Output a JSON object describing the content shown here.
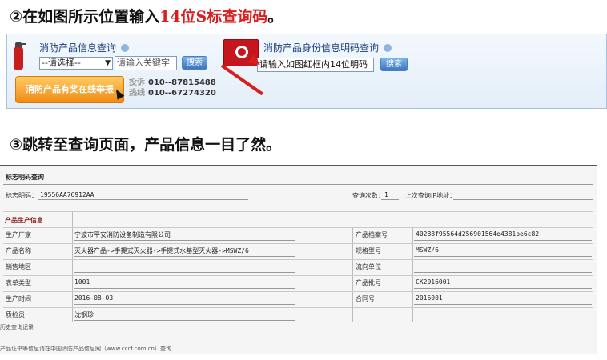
{
  "step2": {
    "prefix": "②在如图所示位置输入",
    "highlight": "14位S标查询码",
    "suffix": "。"
  },
  "step3": {
    "text": "③跳转至查询页面，产品信息一目了然。"
  },
  "search_panel": {
    "product_query_title": "消防产品信息查询",
    "select_value": "--请选择--",
    "keyword_placeholder": "请输入关键字",
    "search_button": "搜索",
    "id_query_title": "消防产品身份信息明码查询",
    "code_placeholder": "请输入如图红框内14位明码",
    "search_button_2": "搜索",
    "report_button": "消防产品有奖在线举报",
    "hotline_label": "投诉热线",
    "hotline_1": "010--87815488",
    "hotline_2": "010--67274320"
  },
  "result": {
    "title": "标志明码查询",
    "code_label": "标志明码：",
    "code_value": "19556AA76912AA",
    "count_label": "查询次数：",
    "count_value": "1",
    "last_ip_label": "上次查询IP地址：",
    "section_title": "产品生产信息",
    "rows": [
      {
        "left_label": "生产厂家",
        "left_value": "宁波市平安消防设备制造有限公司",
        "right_label": "产品档案号",
        "right_value": "40288f95564d256901564e4381be6c82"
      },
      {
        "left_label": "产品名称",
        "left_value": "灭火器产品->手提式灭火器->手提式水基型灭火器->MSWZ/6",
        "right_label": "规格型号",
        "right_value": "MSWZ/6"
      },
      {
        "left_label": "销售地区",
        "left_value": "",
        "right_label": "流向单位",
        "right_value": ""
      },
      {
        "left_label": "表单类型",
        "left_value": "1001",
        "right_label": "产品批号",
        "right_value": "CK2016001"
      },
      {
        "left_label": "生产时间",
        "left_value": "2016-08-03",
        "right_label": "合同号",
        "right_value": "2016001"
      },
      {
        "left_label": "质检员",
        "left_value": "沈钢珍",
        "right_label": "",
        "right_value": ""
      }
    ],
    "history_link": "历史查询记录",
    "footer_note": "产品证书等信息请在中国消防产品信息网（www.cccf.com.cn）查询"
  }
}
